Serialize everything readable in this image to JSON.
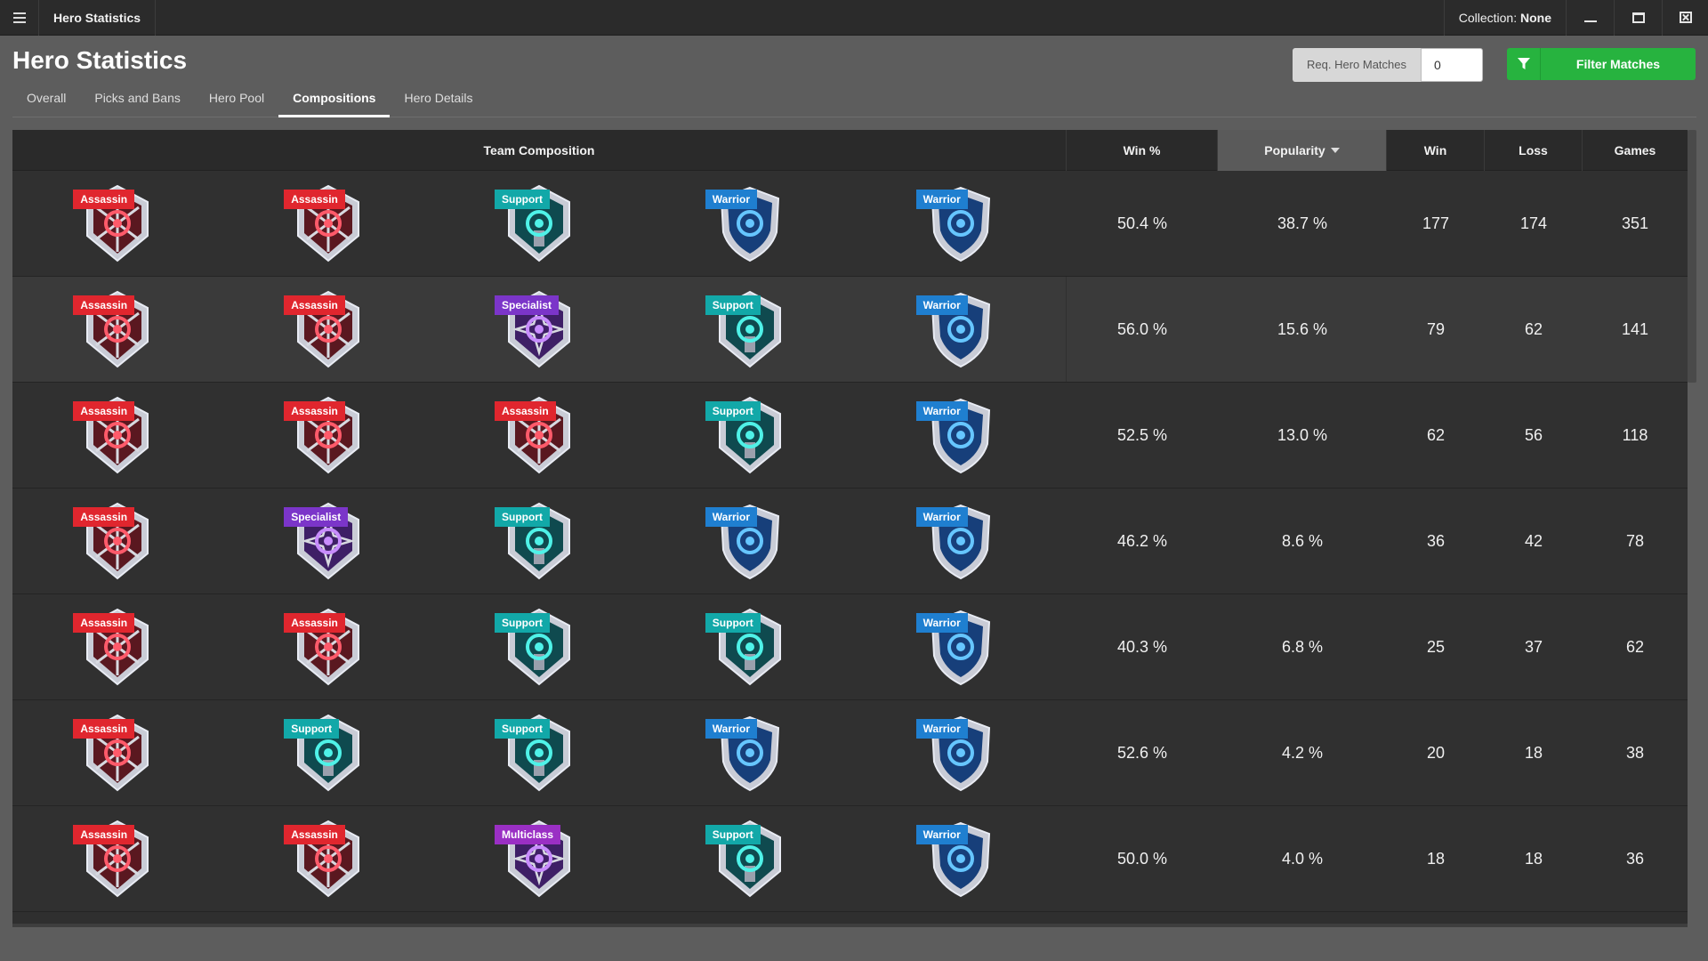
{
  "app": {
    "title": "Hero Statistics",
    "collection_label": "Collection:",
    "collection_value": "None"
  },
  "header": {
    "page_title": "Hero Statistics",
    "req_label": "Req. Hero Matches",
    "req_value": "0",
    "filter_label": "Filter Matches",
    "filter_color": "#27b33f"
  },
  "tabs": [
    {
      "label": "Overall",
      "active": false
    },
    {
      "label": "Picks and Bans",
      "active": false
    },
    {
      "label": "Hero Pool",
      "active": false
    },
    {
      "label": "Compositions",
      "active": true
    },
    {
      "label": "Hero Details",
      "active": false
    }
  ],
  "table": {
    "columns": {
      "composition": "Team Composition",
      "win_pct": "Win %",
      "popularity": "Popularity",
      "win": "Win",
      "loss": "Loss",
      "games": "Games"
    },
    "sorted_by": "popularity",
    "sort_direction": "descending",
    "rows": [
      {
        "roles": [
          "Assassin",
          "Assassin",
          "Support",
          "Warrior",
          "Warrior"
        ],
        "win_pct": "50.4 %",
        "popularity": "38.7 %",
        "win": "177",
        "loss": "174",
        "games": "351"
      },
      {
        "roles": [
          "Assassin",
          "Assassin",
          "Specialist",
          "Support",
          "Warrior"
        ],
        "win_pct": "56.0 %",
        "popularity": "15.6 %",
        "win": "79",
        "loss": "62",
        "games": "141"
      },
      {
        "roles": [
          "Assassin",
          "Assassin",
          "Assassin",
          "Support",
          "Warrior"
        ],
        "win_pct": "52.5 %",
        "popularity": "13.0 %",
        "win": "62",
        "loss": "56",
        "games": "118"
      },
      {
        "roles": [
          "Assassin",
          "Specialist",
          "Support",
          "Warrior",
          "Warrior"
        ],
        "win_pct": "46.2 %",
        "popularity": "8.6 %",
        "win": "36",
        "loss": "42",
        "games": "78"
      },
      {
        "roles": [
          "Assassin",
          "Assassin",
          "Support",
          "Support",
          "Warrior"
        ],
        "win_pct": "40.3 %",
        "popularity": "6.8 %",
        "win": "25",
        "loss": "37",
        "games": "62"
      },
      {
        "roles": [
          "Assassin",
          "Support",
          "Support",
          "Warrior",
          "Warrior"
        ],
        "win_pct": "52.6 %",
        "popularity": "4.2 %",
        "win": "20",
        "loss": "18",
        "games": "38"
      },
      {
        "roles": [
          "Assassin",
          "Assassin",
          "Multiclass",
          "Support",
          "Warrior"
        ],
        "win_pct": "50.0 %",
        "popularity": "4.0 %",
        "win": "18",
        "loss": "18",
        "games": "36"
      }
    ]
  },
  "role_colors": {
    "Assassin": "#e0262e",
    "Support": "#12a8a8",
    "Warrior": "#1f7fd0",
    "Specialist": "#7b35c9",
    "Multiclass": "#9a2fc4"
  },
  "role_icons": {
    "Assassin": "assassin-crest-icon",
    "Support": "support-crest-icon",
    "Warrior": "warrior-crest-icon",
    "Specialist": "specialist-crest-icon",
    "Multiclass": "multiclass-crest-icon"
  }
}
